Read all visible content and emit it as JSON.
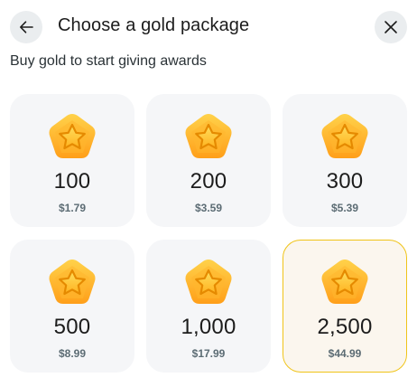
{
  "header": {
    "title": "Choose a gold package",
    "subtitle": "Buy gold to start giving awards",
    "back_icon": "arrow-left-icon",
    "close_icon": "close-icon"
  },
  "packages": [
    {
      "amount": "100",
      "price": "$1.79",
      "selected": false
    },
    {
      "amount": "200",
      "price": "$3.59",
      "selected": false
    },
    {
      "amount": "300",
      "price": "$5.39",
      "selected": false
    },
    {
      "amount": "500",
      "price": "$8.99",
      "selected": false
    },
    {
      "amount": "1,000",
      "price": "$17.99",
      "selected": false
    },
    {
      "amount": "2,500",
      "price": "$44.99",
      "selected": true
    }
  ],
  "colors": {
    "card_bg": "#f5f6f8",
    "selected_bg": "#fbf6ee",
    "selected_border": "#f0c419",
    "coin_gold": "#ffb627",
    "price_text": "#5c6c74"
  },
  "icons": {
    "coin": "gold-star-coin-icon"
  }
}
